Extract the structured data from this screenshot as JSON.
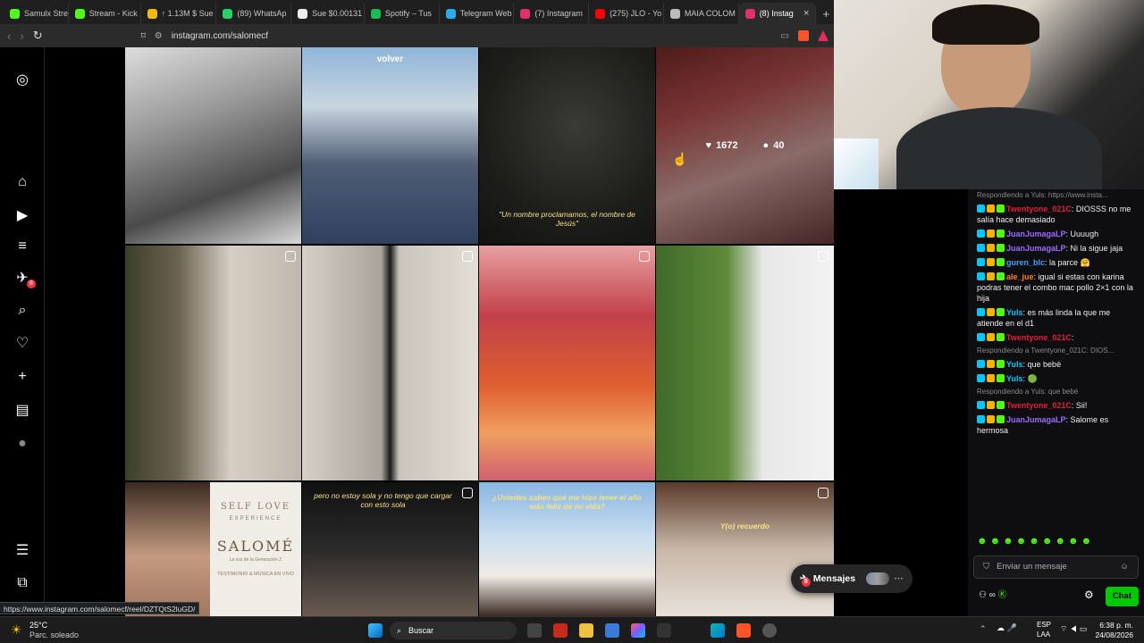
{
  "browser": {
    "tabs": [
      {
        "label": "Samulx Strea",
        "color": "#53fc18"
      },
      {
        "label": "Stream - Kick",
        "color": "#53fc18"
      },
      {
        "label": "↑ 1.13M $ Sue",
        "color": "#f0b90b"
      },
      {
        "label": "(89) WhatsAp",
        "color": "#25d366"
      },
      {
        "label": "Sue $0.00131",
        "color": "#eeeeee"
      },
      {
        "label": "Spotify – Tus",
        "color": "#1db954"
      },
      {
        "label": "Telegram Web",
        "color": "#2aabee"
      },
      {
        "label": "(7) Instagram",
        "color": "#e1306c"
      },
      {
        "label": "(275) JLO - Yo",
        "color": "#ff0000"
      },
      {
        "label": "MAIA COLOM",
        "color": "#bbbbbb"
      },
      {
        "label": "(8) Instag",
        "color": "#e1306c"
      }
    ],
    "tab_close": "×",
    "new_tab": "+",
    "url": "instagram.com/salomecf",
    "status_url": "https://www.instagram.com/salomecf/reel/DZTQtS2luGD/"
  },
  "leftnav": {
    "items": [
      {
        "name": "instagram-logo-icon",
        "glyph": "◎"
      },
      {
        "name": "home-icon",
        "glyph": "⌂"
      },
      {
        "name": "reels-icon",
        "glyph": "▶"
      },
      {
        "name": "threads-icon",
        "glyph": "≡"
      },
      {
        "name": "messenger-icon",
        "glyph": "✈"
      },
      {
        "name": "search-icon",
        "glyph": "⌕"
      },
      {
        "name": "heart-icon",
        "glyph": "♡"
      },
      {
        "name": "create-icon",
        "glyph": "+"
      },
      {
        "name": "dashboard-icon",
        "glyph": "▤"
      },
      {
        "name": "profile-icon",
        "glyph": "●"
      },
      {
        "name": "menu-icon",
        "glyph": "☰"
      },
      {
        "name": "more-apps-icon",
        "glyph": "⧉"
      }
    ],
    "messenger_badge": "8"
  },
  "grid": {
    "posts": [
      {
        "caption": ""
      },
      {
        "caption": "volver"
      },
      {
        "caption": "\"Un nombre proclamamos, el nombre de Jesús\""
      },
      {
        "likes": "1672",
        "comments": "40"
      },
      {
        "caption": ""
      },
      {
        "caption": ""
      },
      {
        "caption": ""
      },
      {
        "caption": ""
      },
      {
        "title": "SELF LOVE",
        "subtitle": "EXPERIENCE",
        "name": "SALOMÉ",
        "tagline": "La voz de la Generación Z",
        "footer": "TESTIMONIO & MÚSICA EN VIVO"
      },
      {
        "caption": "pero no estoy sola y no tengo que cargar con esto sola"
      },
      {
        "caption": "¿Ustedes saben qué me hizo tener el año más feliz de mi vida?"
      },
      {
        "caption": "Y(o) recuerdo"
      }
    ]
  },
  "messages_pill": {
    "label": "Mensajes",
    "badge": "8"
  },
  "chat": {
    "messages": [
      {
        "reply": "Respondiendo a Yuls: https://www.insta..."
      },
      {
        "user": "Twentyone_021C",
        "color": "#e0203a",
        "text": "DIOSSS no me salía hace demasiado"
      },
      {
        "user": "JuanJumagaLP",
        "color": "#9b6bff",
        "text": "Uuuugh"
      },
      {
        "user": "JuanJumagaLP",
        "color": "#9b6bff",
        "text": "Ni la sigue jaja"
      },
      {
        "user": "guren_blc",
        "color": "#3aa3ff",
        "text": "la parce 🤗"
      },
      {
        "user": "ale_jue",
        "color": "#ff7f27",
        "text": "igual si estas con karina podras tener el combo mac pollo 2×1 con la hija"
      },
      {
        "user": "Yuls",
        "color": "#00c8ff",
        "text": "es más linda la que me atiende en el d1"
      },
      {
        "user": "Twentyone_021C",
        "color": "#e0203a",
        "text": ""
      },
      {
        "reply": "Respondiendo a Twentyone_021C: DIOS..."
      },
      {
        "user": "Yuls",
        "color": "#00c8ff",
        "text": "que bebé"
      },
      {
        "user": "Yuls",
        "color": "#00c8ff",
        "text": "🟢"
      },
      {
        "reply": "Respondiendo a Yuls: que bebé"
      },
      {
        "user": "Twentyone_021C",
        "color": "#e0203a",
        "text": "Sii!"
      },
      {
        "user": "JuanJumagaLP",
        "color": "#9b6bff",
        "text": "Salome es hermosa"
      }
    ],
    "input_placeholder": "Enviar un mensaje",
    "send_label": "Chat"
  },
  "taskbar": {
    "weather_temp": "25°C",
    "weather_desc": "Parc. soleado",
    "search_placeholder": "Buscar",
    "lang": "ESP",
    "lang2": "LAA",
    "time": "6:38 p. m.",
    "date": "24/08/2026"
  }
}
